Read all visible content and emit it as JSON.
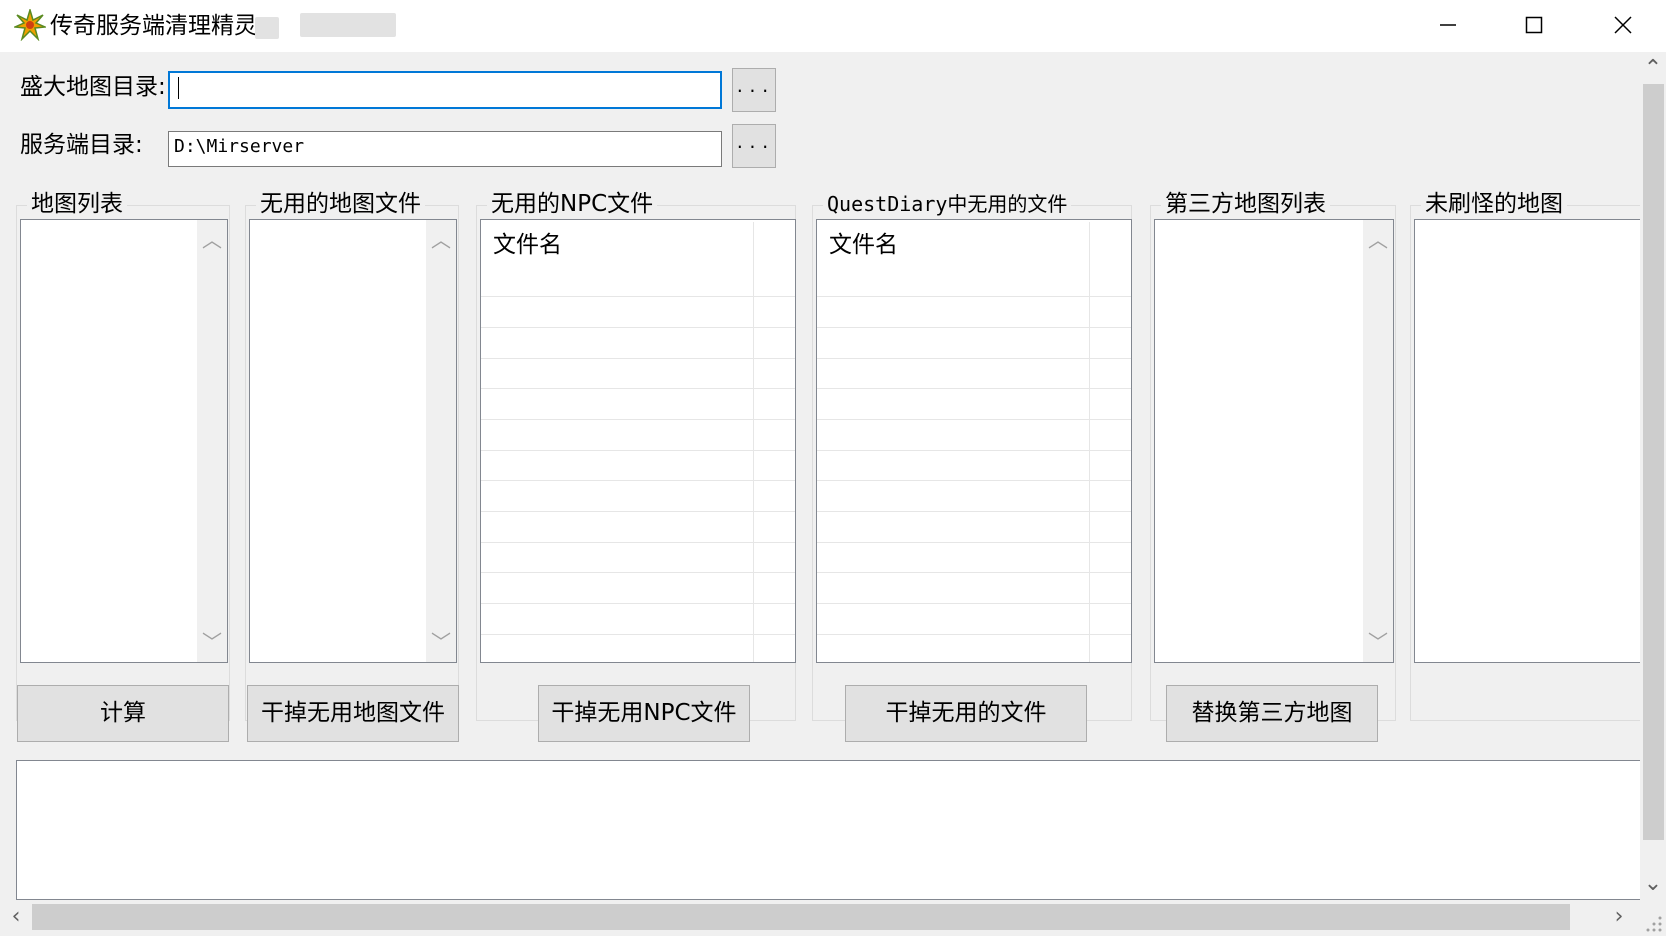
{
  "window": {
    "title": "传奇服务端清理精灵",
    "controls": [
      "minimize",
      "maximize",
      "close"
    ]
  },
  "paths": {
    "shanda_map_label": "盛大地图目录:",
    "shanda_map_value": "",
    "server_label": "服务端目录:",
    "server_value": "D:\\Mirserver",
    "browse_label": "..."
  },
  "groups": {
    "map_list": "地图列表",
    "unused_map_files": "无用的地图文件",
    "unused_npc_files": "无用的NPC文件",
    "questdiary_unused": "QuestDiary中无用的文件",
    "third_party_maps": "第三方地图列表",
    "unspawned_maps": "未刷怪的地图"
  },
  "listviews": {
    "npc_column": "文件名",
    "questdiary_column": "文件名"
  },
  "buttons": {
    "calculate": "计算",
    "remove_unused_maps": "干掉无用地图文件",
    "remove_unused_npc": "干掉无用NPC文件",
    "remove_unused_files": "干掉无用的文件",
    "replace_third_party": "替换第三方地图"
  },
  "log": {
    "text": ""
  },
  "icons": {
    "app": "star-icon",
    "minimize": "minimize-icon",
    "maximize": "maximize-icon",
    "close": "close-icon"
  },
  "colors": {
    "focus_border": "#0078d7",
    "client_bg": "#f0f0f0",
    "button_bg": "#e1e1e1"
  }
}
